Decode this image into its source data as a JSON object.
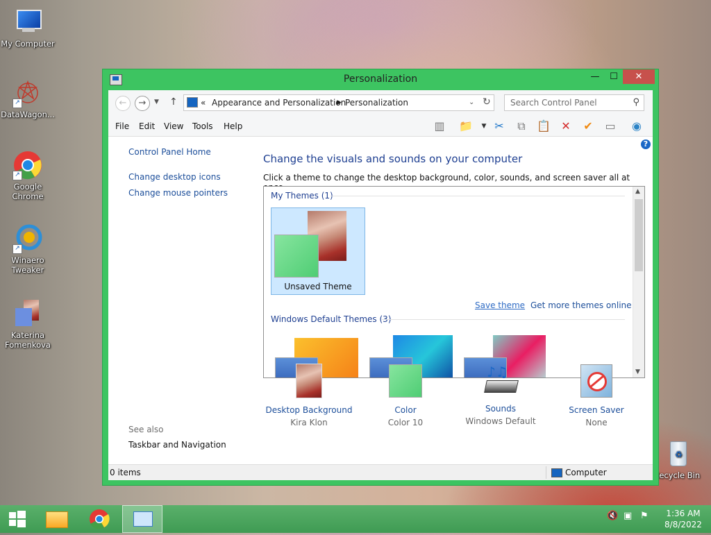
{
  "desktop": {
    "icons": [
      {
        "label": "My Computer"
      },
      {
        "label": "DataWagon..."
      },
      {
        "label": "Google Chrome"
      },
      {
        "label": "Winaero Tweaker"
      },
      {
        "label": "Katerina Fomenkova"
      },
      {
        "label": "Recycle Bin"
      }
    ]
  },
  "window": {
    "title": "Personalization",
    "breadcrumb": [
      "Appearance and Personalization",
      "Personalization"
    ],
    "breadcrumb_prefix": "«",
    "search_placeholder": "Search Control Panel",
    "menu": [
      "File",
      "Edit",
      "View",
      "Tools",
      "Help"
    ]
  },
  "sidebar": {
    "home": "Control Panel Home",
    "links": [
      "Change desktop icons",
      "Change mouse pointers"
    ],
    "see_also_title": "See also",
    "see_also": [
      "Taskbar and Navigation"
    ]
  },
  "main": {
    "heading": "Change the visuals and sounds on your computer",
    "subheading": "Click a theme to change the desktop background, color, sounds, and screen saver all at once.",
    "my_themes_title": "My Themes (1)",
    "unsaved_theme": "Unsaved Theme",
    "save_theme": "Save theme",
    "get_more": "Get more themes online",
    "default_themes_title": "Windows Default Themes (3)"
  },
  "settings": [
    {
      "label": "Desktop Background",
      "value": "Kira Klon"
    },
    {
      "label": "Color",
      "value": "Color 10"
    },
    {
      "label": "Sounds",
      "value": "Windows Default"
    },
    {
      "label": "Screen Saver",
      "value": "None"
    }
  ],
  "status": {
    "items": "0 items",
    "location": "Computer"
  },
  "taskbar": {
    "time": "1:36 AM",
    "date": "8/8/2022"
  }
}
